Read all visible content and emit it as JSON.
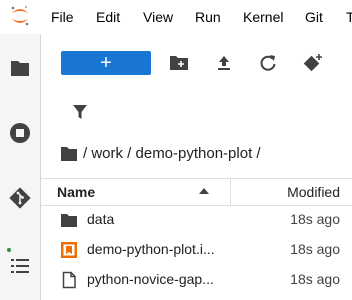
{
  "menu": [
    "File",
    "Edit",
    "View",
    "Run",
    "Kernel",
    "Git",
    "T"
  ],
  "toolbar": {
    "new_label": "+",
    "icons": [
      "new-folder-icon",
      "upload-icon",
      "refresh-icon",
      "git-clone-icon"
    ]
  },
  "breadcrumb": "/ work / demo-python-plot /",
  "list": {
    "name_header": "Name",
    "modified_header": "Modified",
    "rows": [
      {
        "name": "data",
        "modified": "18s ago",
        "icon": "folder-icon"
      },
      {
        "name": "demo-python-plot.i...",
        "modified": "18s ago",
        "icon": "notebook-icon",
        "running": true
      },
      {
        "name": "python-novice-gap...",
        "modified": "18s ago",
        "icon": "file-icon"
      }
    ]
  },
  "colors": {
    "accent": "#1976d2",
    "notebook": "#ef6c00",
    "running": "#388e3c",
    "logo": "#f37726"
  }
}
